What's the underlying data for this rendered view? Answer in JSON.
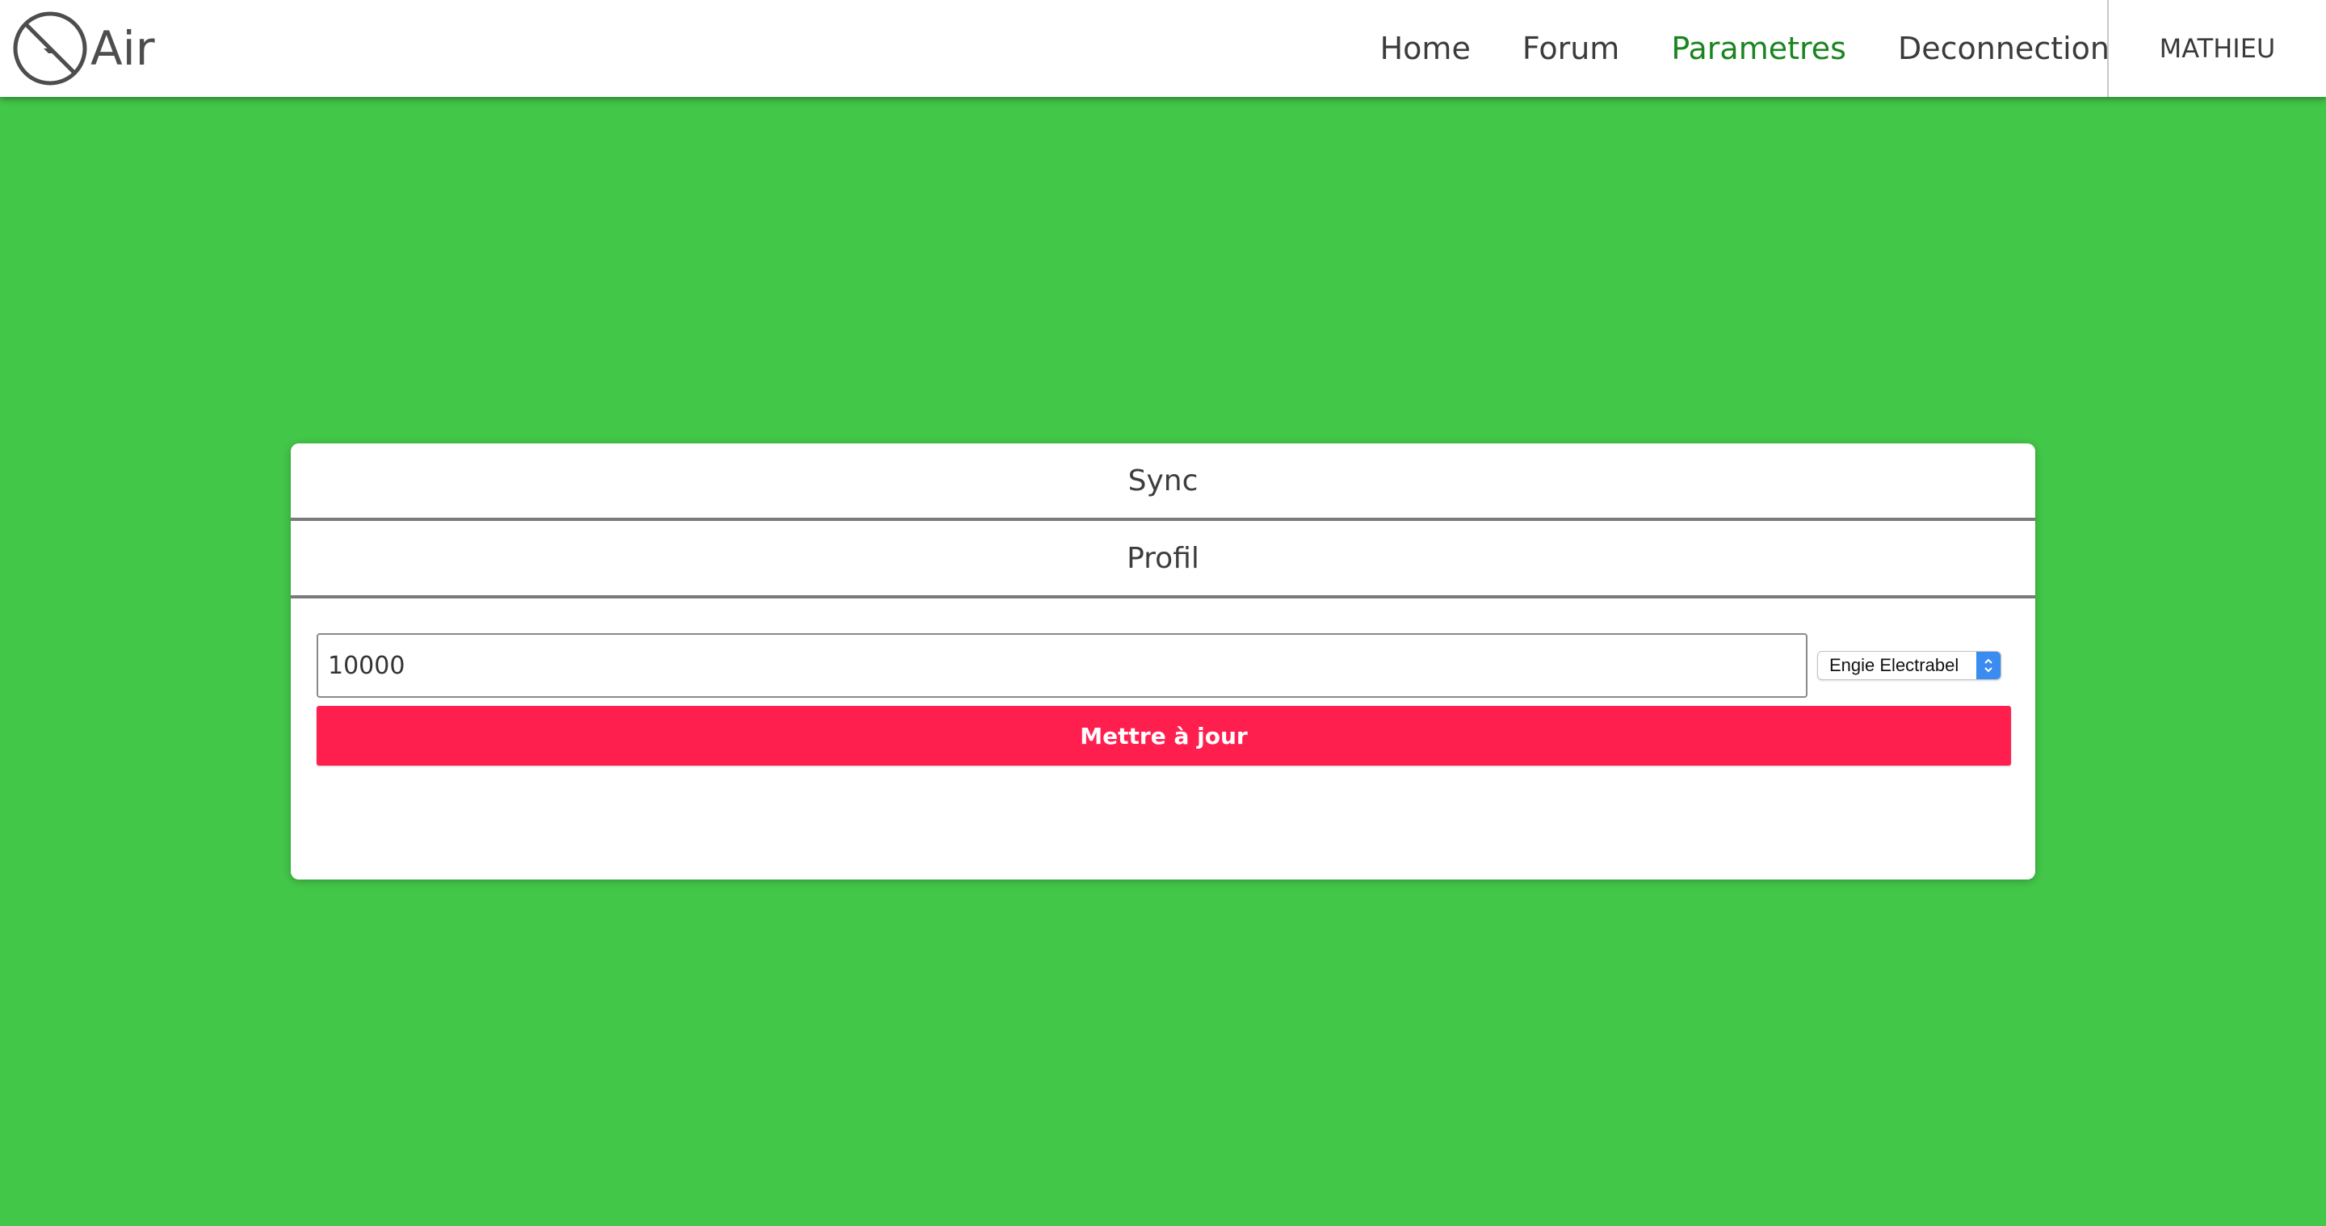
{
  "brand": {
    "name": "Air",
    "logo_icon": "lightning-bolt-circle-icon"
  },
  "nav": {
    "links": [
      {
        "label": "Home",
        "active": false
      },
      {
        "label": "Forum",
        "active": false
      },
      {
        "label": "Parametres",
        "active": true
      },
      {
        "label": "Deconnection",
        "active": false
      }
    ],
    "user": "MATHIEU"
  },
  "card": {
    "sections": [
      {
        "label": "Sync"
      },
      {
        "label": "Profil"
      }
    ],
    "amount_value": "10000",
    "provider_selected": "Engie Electrabel",
    "update_label": "Mettre à jour"
  },
  "colors": {
    "background": "#43c749",
    "active_link": "#19851f",
    "button": "#ff1f4e",
    "select_accent": "#3b8cf0"
  }
}
